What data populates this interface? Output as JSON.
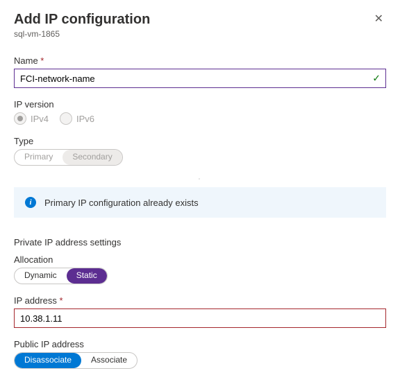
{
  "header": {
    "title": "Add IP configuration",
    "subtitle": "sql-vm-1865"
  },
  "fields": {
    "name": {
      "label": "Name",
      "value": "FCI-network-name"
    },
    "ip_version": {
      "label": "IP version",
      "options": {
        "ipv4": "IPv4",
        "ipv6": "IPv6"
      }
    },
    "type": {
      "label": "Type",
      "options": {
        "primary": "Primary",
        "secondary": "Secondary"
      }
    },
    "allocation": {
      "label": "Allocation",
      "options": {
        "dynamic": "Dynamic",
        "static": "Static"
      }
    },
    "ip_address": {
      "label": "IP address",
      "value": "10.38.1.11"
    },
    "public_ip": {
      "label": "Public IP address",
      "options": {
        "disassociate": "Disassociate",
        "associate": "Associate"
      }
    }
  },
  "section": {
    "private_ip": "Private IP address settings"
  },
  "banner": {
    "info": "Primary IP configuration already exists"
  }
}
